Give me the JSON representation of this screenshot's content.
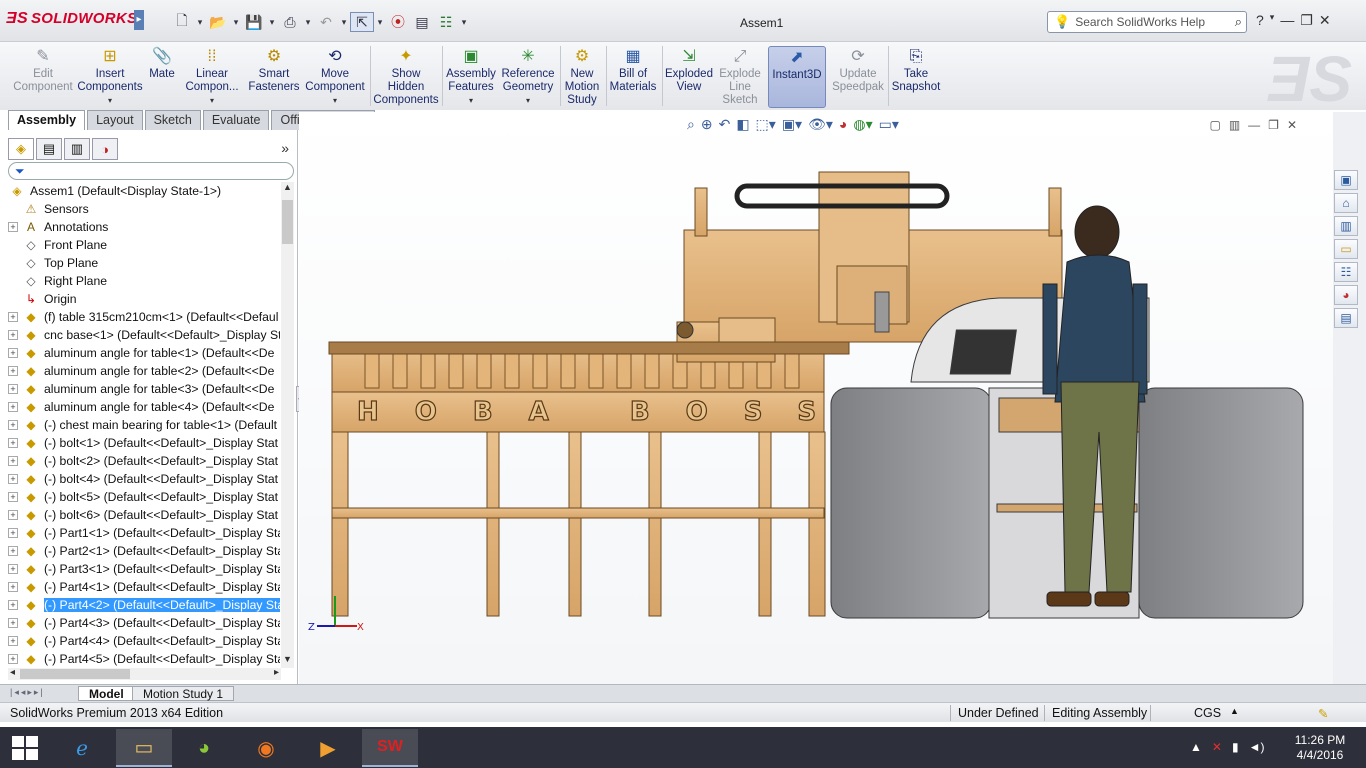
{
  "app": {
    "brand": "SOLIDWORKS",
    "window_title": "Assem1",
    "search_placeholder": "Search SolidWorks Help",
    "help_label": "?",
    "accent_color": "#d4002a"
  },
  "ribbon": {
    "buttons": [
      {
        "label": "Edit Component",
        "icon": "edit-component-icon",
        "disabled": true
      },
      {
        "label": "Insert Components",
        "icon": "insert-components-icon",
        "dropdown": true
      },
      {
        "label": "Mate",
        "icon": "mate-icon"
      },
      {
        "label": "Linear Compon...",
        "icon": "linear-pattern-icon",
        "dropdown": true
      },
      {
        "label": "Smart Fasteners",
        "icon": "smart-fasteners-icon"
      },
      {
        "label": "Move Component",
        "icon": "move-component-icon",
        "dropdown": true
      },
      {
        "label": "Show Hidden Components",
        "icon": "show-hidden-icon"
      },
      {
        "label": "Assembly Features",
        "icon": "assembly-features-icon",
        "dropdown": true
      },
      {
        "label": "Reference Geometry",
        "icon": "reference-geometry-icon",
        "dropdown": true
      },
      {
        "label": "New Motion Study",
        "icon": "motion-study-icon"
      },
      {
        "label": "Bill of Materials",
        "icon": "bill-of-materials-icon"
      },
      {
        "label": "Exploded View",
        "icon": "exploded-view-icon"
      },
      {
        "label": "Explode Line Sketch",
        "icon": "explode-line-icon",
        "disabled": true
      },
      {
        "label": "Instant3D",
        "icon": "instant3d-icon",
        "active": true
      },
      {
        "label": "Update Speedpak",
        "icon": "speedpak-icon",
        "disabled": true
      },
      {
        "label": "Take Snapshot",
        "icon": "snapshot-icon"
      }
    ]
  },
  "tabs": [
    "Assembly",
    "Layout",
    "Sketch",
    "Evaluate",
    "Office Products"
  ],
  "tree": {
    "filter_icon": "filter-icon",
    "root": "Assem1  (Default<Display State-1>)",
    "items": [
      {
        "label": "Sensors",
        "icon": "sensors-icon",
        "expand": false
      },
      {
        "label": "Annotations",
        "icon": "annotations-icon",
        "expand": true
      },
      {
        "label": "Front Plane",
        "icon": "plane-icon",
        "expand": false
      },
      {
        "label": "Top Plane",
        "icon": "plane-icon",
        "expand": false
      },
      {
        "label": "Right Plane",
        "icon": "plane-icon",
        "expand": false
      },
      {
        "label": "Origin",
        "icon": "origin-icon",
        "expand": false
      },
      {
        "label": "(f) table 315cm210cm<1> (Default<<Defaul",
        "icon": "part-icon",
        "expand": true
      },
      {
        "label": "cnc base<1> (Default<<Default>_Display St",
        "icon": "part-icon",
        "expand": true
      },
      {
        "label": "aluminum angle for table<1> (Default<<De",
        "icon": "part-icon",
        "expand": true
      },
      {
        "label": "aluminum angle for table<2> (Default<<De",
        "icon": "part-icon",
        "expand": true
      },
      {
        "label": "aluminum angle for table<3> (Default<<De",
        "icon": "part-icon",
        "expand": true
      },
      {
        "label": "aluminum angle for table<4> (Default<<De",
        "icon": "part-icon",
        "expand": true
      },
      {
        "label": "(-) chest main bearing for table<1> (Default",
        "icon": "part-icon",
        "expand": true
      },
      {
        "label": "(-) bolt<1> (Default<<Default>_Display Stat",
        "icon": "part-icon",
        "expand": true
      },
      {
        "label": "(-) bolt<2> (Default<<Default>_Display Stat",
        "icon": "part-icon",
        "expand": true
      },
      {
        "label": "(-) bolt<4> (Default<<Default>_Display Stat",
        "icon": "part-icon",
        "expand": true
      },
      {
        "label": "(-) bolt<5> (Default<<Default>_Display Stat",
        "icon": "part-icon",
        "expand": true
      },
      {
        "label": "(-) bolt<6> (Default<<Default>_Display Stat",
        "icon": "part-icon",
        "expand": true
      },
      {
        "label": "(-) Part1<1> (Default<<Default>_Display Sta",
        "icon": "part-icon",
        "expand": true
      },
      {
        "label": "(-) Part2<1> (Default<<Default>_Display Sta",
        "icon": "part-icon",
        "expand": true
      },
      {
        "label": "(-) Part3<1> (Default<<Default>_Display Sta",
        "icon": "part-icon",
        "expand": true
      },
      {
        "label": "(-) Part4<1> (Default<<Default>_Display Sta",
        "icon": "part-icon",
        "expand": true
      },
      {
        "label": "(-) Part4<2> (Default<<Default>_Display Sta",
        "icon": "part-icon",
        "expand": true,
        "selected": true
      },
      {
        "label": "(-) Part4<3> (Default<<Default>_Display Sta",
        "icon": "part-icon",
        "expand": true
      },
      {
        "label": "(-) Part4<4> (Default<<Default>_Display Sta",
        "icon": "part-icon",
        "expand": true
      },
      {
        "label": "(-) Part4<5> (Default<<Default>_Display Sta",
        "icon": "part-icon",
        "expand": true
      }
    ]
  },
  "viewport": {
    "engraving": "HOBA BOSS",
    "triad_x": "X",
    "triad_z": "Z"
  },
  "bottom_tabs": [
    "Model",
    "Motion Study 1"
  ],
  "status": {
    "edition": "SolidWorks Premium 2013 x64 Edition",
    "definition": "Under Defined",
    "mode": "Editing Assembly",
    "units": "CGS"
  },
  "taskbar": {
    "time": "11:26 PM",
    "date": "4/4/2016"
  }
}
